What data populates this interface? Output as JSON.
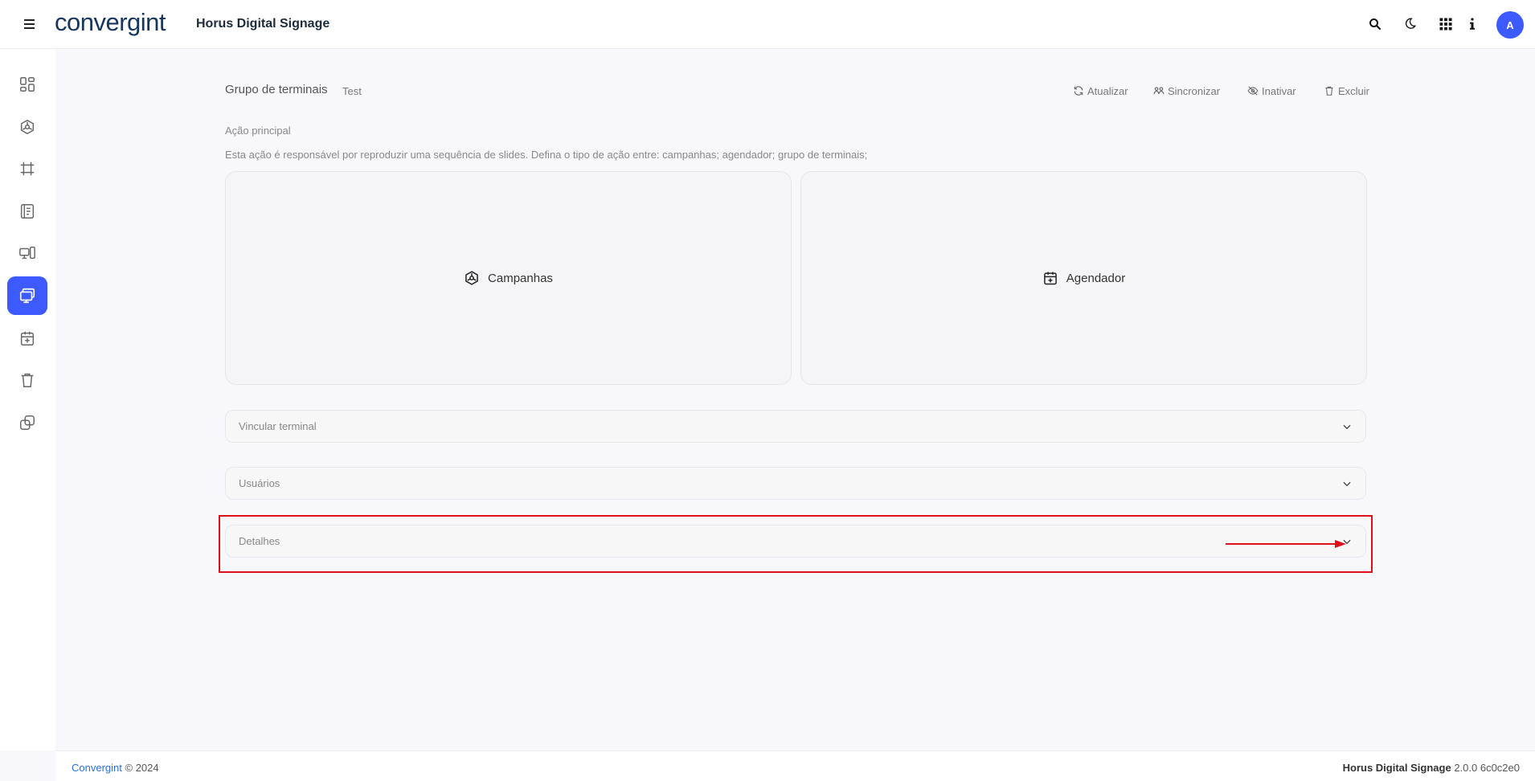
{
  "header": {
    "logo_text": "convergint",
    "app_title": "Horus Digital Signage",
    "avatar_initial": "A",
    "icons": [
      "search-icon",
      "moon-icon",
      "apps-grid-icon",
      "info-icon"
    ]
  },
  "sidebar": {
    "items": [
      {
        "icon": "dashboard-icon",
        "active": false
      },
      {
        "icon": "campaign-icon",
        "active": false
      },
      {
        "icon": "frame-icon",
        "active": false
      },
      {
        "icon": "content-icon",
        "active": false
      },
      {
        "icon": "devices-icon",
        "active": false
      },
      {
        "icon": "terminal-group-icon",
        "active": true
      },
      {
        "icon": "scheduler-icon",
        "active": false
      },
      {
        "icon": "trash-icon",
        "active": false
      },
      {
        "icon": "copy-icon",
        "active": false
      }
    ],
    "accent": "#3d5afe"
  },
  "page": {
    "title": "Grupo de terminais",
    "subtitle": "Test",
    "actions": {
      "refresh": "Atualizar",
      "sync": "Sincronizar",
      "deactivate": "Inativar",
      "delete": "Excluir"
    },
    "section_label": "Ação principal",
    "section_desc": "Esta ação é responsável por reproduzir uma sequência de slides. Defina o tipo de ação entre: campanhas; agendador; grupo de terminais;",
    "cards": {
      "campaigns": "Campanhas",
      "scheduler": "Agendador"
    },
    "accordions": {
      "link_terminal": "Vincular terminal",
      "users": "Usuários",
      "details": "Detalhes"
    }
  },
  "footer": {
    "brand": "Convergint",
    "copyright": "© 2024",
    "product": "Horus Digital Signage",
    "version": "2.0.0 6c0c2e0"
  },
  "annotation": {
    "color": "#e0101a"
  }
}
